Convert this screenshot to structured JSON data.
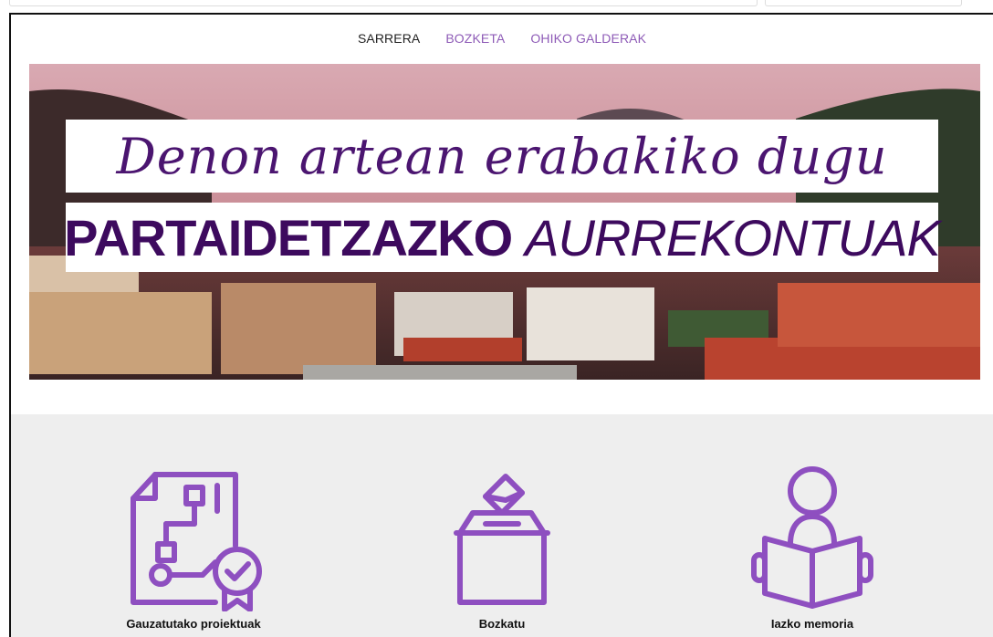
{
  "nav": {
    "items": [
      {
        "label": "SARRERA",
        "active": true
      },
      {
        "label": "BOZKETA",
        "active": false
      },
      {
        "label": "OHIKO GALDERAK",
        "active": false
      }
    ]
  },
  "hero": {
    "script_line": "Denon artean erabakiko dugu",
    "title_bold": "PARTAIDETZAZKO",
    "title_light": "AURREKONTUAK"
  },
  "features": [
    {
      "label": "Gauzatutako proiektuak",
      "icon": "certified-document-icon"
    },
    {
      "label": "Bozkatu",
      "icon": "ballot-box-icon"
    },
    {
      "label": "Iazko memoria",
      "icon": "reading-person-icon"
    }
  ],
  "colors": {
    "accent": "#8e5bb7",
    "icon": "#8e4fc0",
    "banner_text": "#3d0a5e",
    "section_bg": "#eeeeee"
  }
}
